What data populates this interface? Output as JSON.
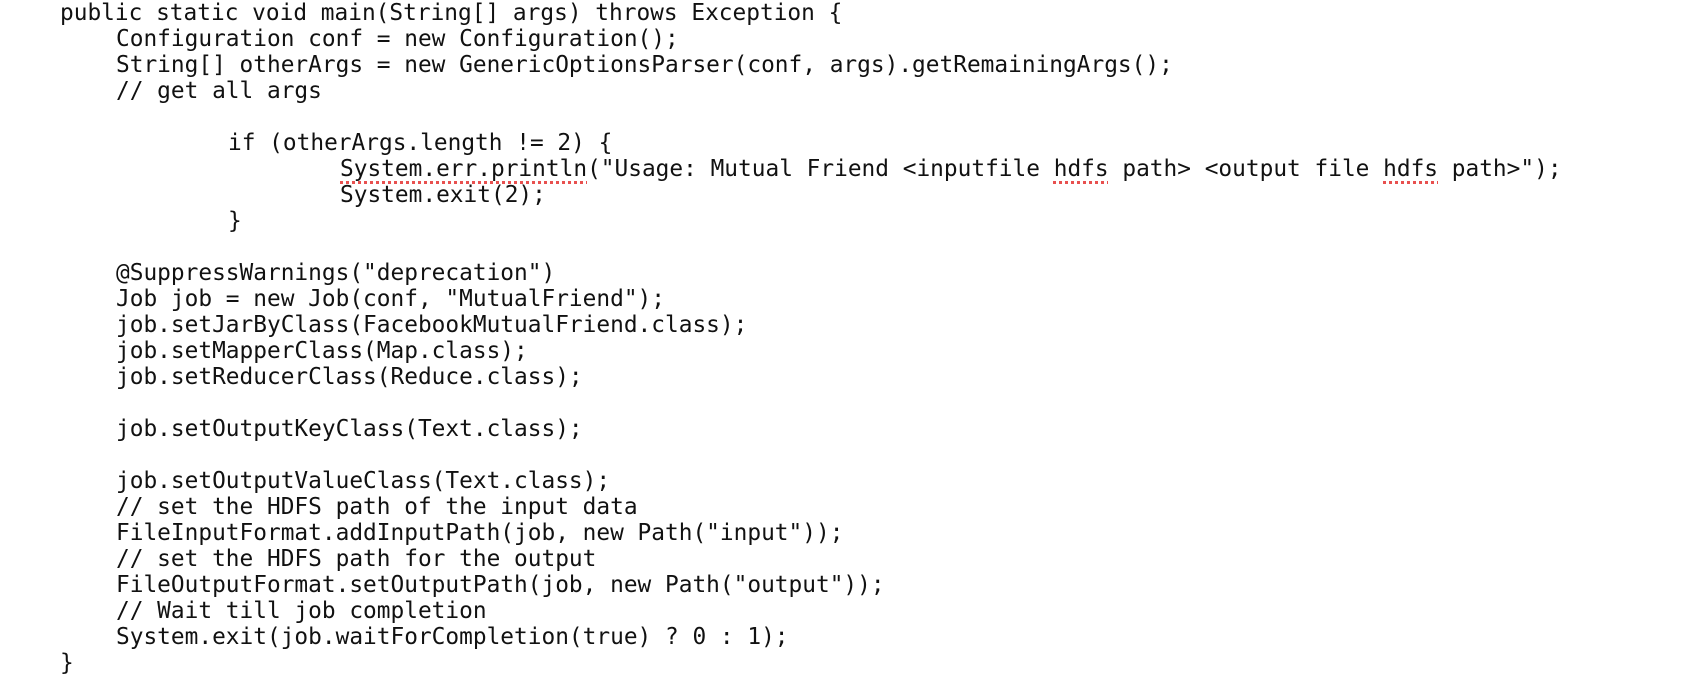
{
  "editor": {
    "lines": [
      {
        "indent": 0,
        "text": "public static void main(String[] args) throws Exception {"
      },
      {
        "indent": 1,
        "text": "Configuration conf = new Configuration();"
      },
      {
        "indent": 1,
        "text": "String[] otherArgs = new GenericOptionsParser(conf, args).getRemainingArgs();"
      },
      {
        "indent": 1,
        "text": "// get all args"
      },
      {
        "indent": 0,
        "text": ""
      },
      {
        "indent": 2,
        "text": "if (otherArgs.length != 2) {"
      },
      {
        "indent": 3,
        "segments": [
          {
            "text": "System.err.println",
            "flag": "spelling"
          },
          {
            "text": "(\"Usage: Mutual Friend <inputfile "
          },
          {
            "text": "hdfs",
            "flag": "spelling"
          },
          {
            "text": " path> <output file "
          },
          {
            "text": "hdfs",
            "flag": "spelling"
          },
          {
            "text": " path>\");"
          }
        ]
      },
      {
        "indent": 3,
        "text": "System.exit(2);"
      },
      {
        "indent": 2,
        "text": "}"
      },
      {
        "indent": 0,
        "text": ""
      },
      {
        "indent": 1,
        "text": "@SuppressWarnings(\"deprecation\")"
      },
      {
        "indent": 1,
        "text": "Job job = new Job(conf, \"MutualFriend\");"
      },
      {
        "indent": 1,
        "text": "job.setJarByClass(FacebookMutualFriend.class);"
      },
      {
        "indent": 1,
        "text": "job.setMapperClass(Map.class);"
      },
      {
        "indent": 1,
        "text": "job.setReducerClass(Reduce.class);"
      },
      {
        "indent": 0,
        "text": ""
      },
      {
        "indent": 1,
        "text": "job.setOutputKeyClass(Text.class);"
      },
      {
        "indent": 0,
        "text": ""
      },
      {
        "indent": 1,
        "text": "job.setOutputValueClass(Text.class);"
      },
      {
        "indent": 1,
        "text": "// set the HDFS path of the input data"
      },
      {
        "indent": 1,
        "text": "FileInputFormat.addInputPath(job, new Path(\"input\"));"
      },
      {
        "indent": 1,
        "text": "// set the HDFS path for the output"
      },
      {
        "indent": 1,
        "text": "FileOutputFormat.setOutputPath(job, new Path(\"output\"));"
      },
      {
        "indent": 1,
        "text": "// Wait till job completion"
      },
      {
        "indent": 1,
        "text": "System.exit(job.waitForCompletion(true) ? 0 : 1);"
      },
      {
        "indent": 0,
        "text": "}"
      }
    ]
  }
}
